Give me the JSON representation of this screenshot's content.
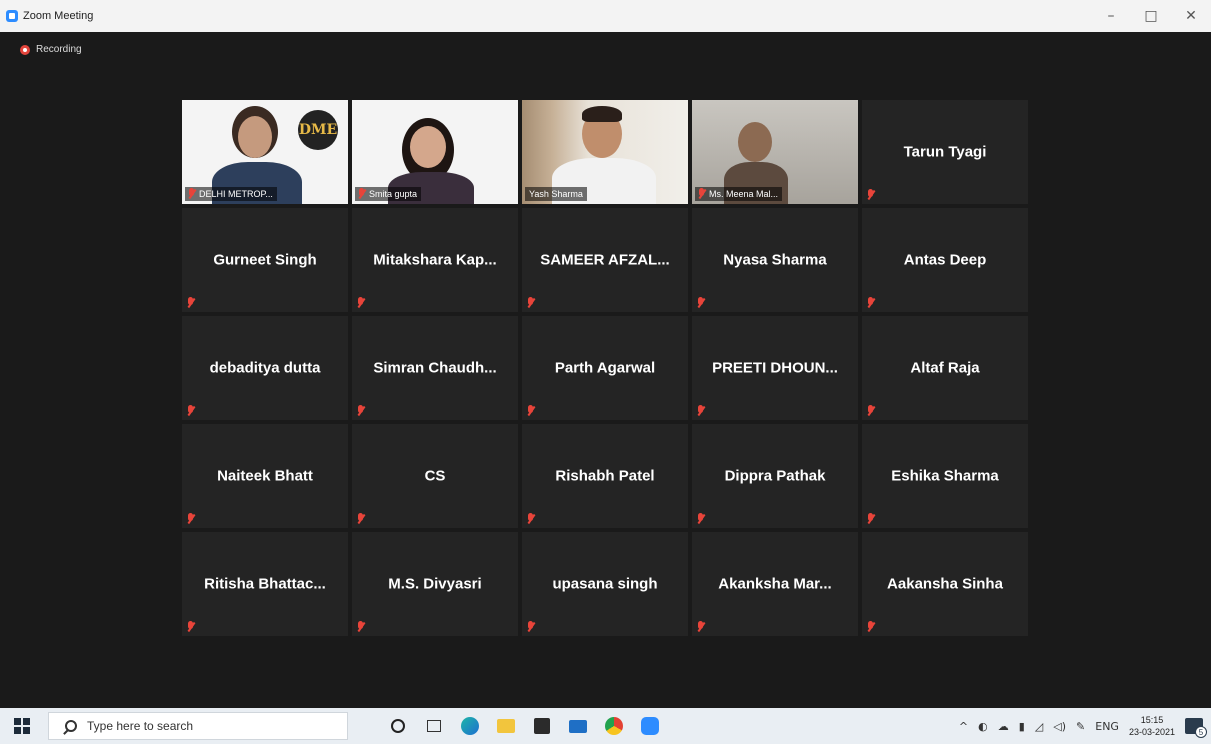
{
  "window": {
    "title": "Zoom Meeting",
    "minimize": "–",
    "maximize": "□",
    "close": "✕"
  },
  "meeting": {
    "recording_label": "Recording",
    "active_speaker_color": "#c9de2f",
    "muted_color": "#e8443a"
  },
  "video_tiles": [
    {
      "name": "DELHI METROP...",
      "logo_text": "DME",
      "muted": true
    },
    {
      "name": "Smita gupta",
      "muted": true
    },
    {
      "name": "Yash Sharma",
      "muted": false,
      "active_speaker": true
    },
    {
      "name": "Ms. Meena Mal...",
      "muted": true
    }
  ],
  "name_tiles": [
    "Tarun Tyagi",
    "Gurneet Singh",
    "Mitakshara  Kap...",
    "SAMEER  AFZAL...",
    "Nyasa Sharma",
    "Antas Deep",
    "debaditya dutta",
    "Simran  Chaudh...",
    "Parth Agarwal",
    "PREETI  DHOUN...",
    "Altaf Raja",
    "Naiteek Bhatt",
    "CS",
    "Rishabh Patel",
    "Dippra Pathak",
    "Eshika Sharma",
    "Ritisha  Bhattac...",
    "M.S. Divyasri",
    "upasana singh",
    "Akanksha  Mar...",
    "Aakansha Sinha"
  ],
  "taskbar": {
    "search_placeholder": "Type here to search",
    "apps": [
      "cortana-icon",
      "task-view-icon",
      "edge-icon",
      "file-explorer-icon",
      "store-icon",
      "mail-icon",
      "chrome-icon",
      "zoom-icon"
    ],
    "language": "ENG",
    "time": "15:15",
    "date": "23-03-2021",
    "notification_count": "5"
  }
}
